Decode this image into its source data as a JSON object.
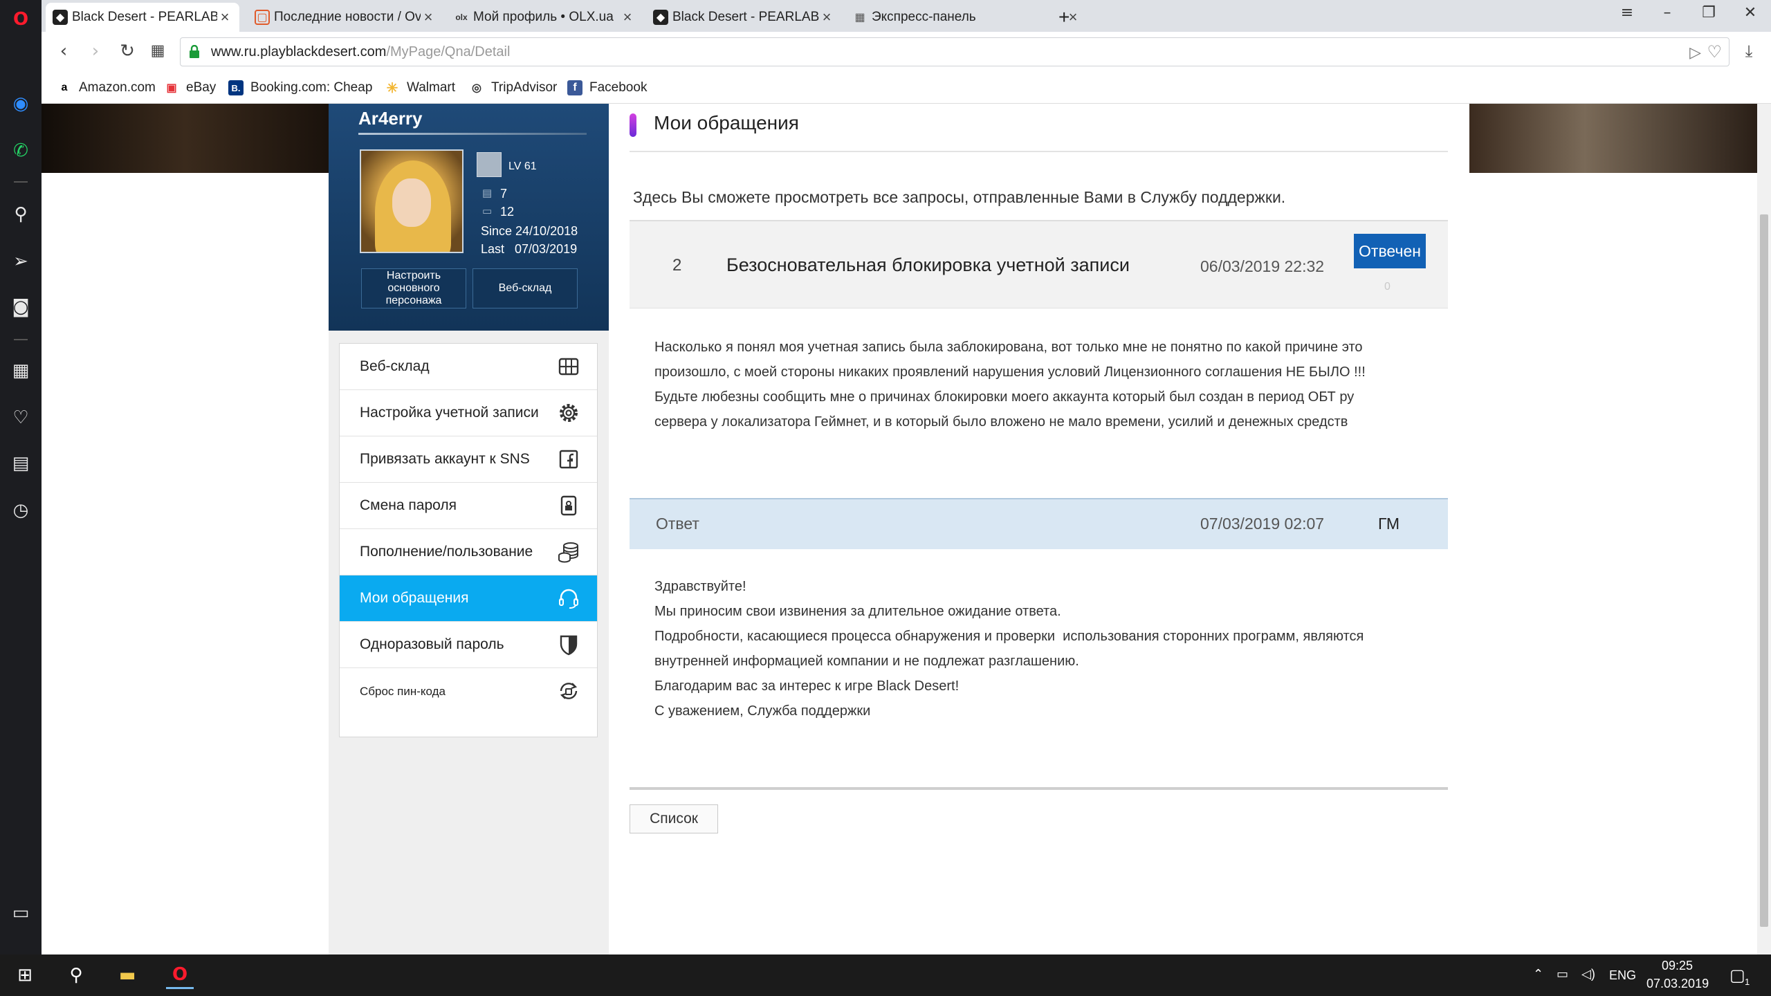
{
  "browser": {
    "tabs": [
      {
        "title": "Black Desert - PEARLABYSS",
        "active": true
      },
      {
        "title": "Последние новости / Overclockers"
      },
      {
        "title": "Мой профиль • OLX.ua"
      },
      {
        "title": "Black Desert - PEARLABYSS"
      },
      {
        "title": "Экспресс-панель"
      }
    ],
    "new_tab": "+",
    "url_host": "www.ru.playblackdesert.com",
    "url_path": "/MyPage/Qna/Detail",
    "bookmarks": [
      {
        "label": "Amazon.com",
        "icon": "a",
        "color": "#000000"
      },
      {
        "label": "eBay",
        "icon": "▣",
        "color": "#e53238"
      },
      {
        "label": "Booking.com: Cheap",
        "icon": "B.",
        "color": "#003580"
      },
      {
        "label": "Walmart",
        "icon": "✳",
        "color": "#f2b632"
      },
      {
        "label": "TripAdvisor",
        "icon": "◎",
        "color": "#333333"
      },
      {
        "label": "Facebook",
        "icon": "f",
        "color": "#3b5998"
      }
    ]
  },
  "profile": {
    "name": "Ar4erry",
    "level": "LV 61",
    "stat1": "7",
    "stat2": "12",
    "since": "Since 24/10/2018",
    "last": "Last   07/03/2019",
    "btn_main_char": "Настроить основного персонажа",
    "btn_web_storage": "Веб-склад"
  },
  "menu": [
    {
      "label": "Веб-склад",
      "icon": "storage-icon"
    },
    {
      "label": "Настройка учетной записи",
      "icon": "gear-icon"
    },
    {
      "label": "Привязать аккаунт к SNS",
      "icon": "facebook-icon"
    },
    {
      "label": "Смена пароля",
      "icon": "lock-icon"
    },
    {
      "label": "Пополнение/пользование",
      "icon": "coins-icon"
    },
    {
      "label": "Мои обращения",
      "icon": "headset-icon",
      "active": true
    },
    {
      "label": "Одноразовый пароль",
      "icon": "shield-icon"
    },
    {
      "label": "Сброс пин-кода",
      "icon": "reset-icon"
    }
  ],
  "main": {
    "title": "Мои обращения",
    "intro": "Здесь Вы сможете просмотреть все запросы, отправленные Вами в Службу поддержки.",
    "question": {
      "number": "2",
      "title": "Безосновательная блокировка учетной записи",
      "date": "06/03/2019 22:32",
      "status": "Отвечен",
      "count": "0",
      "body": [
        "Насколько я понял моя учетная запись была заблокирована, вот только мне не понятно по какой причине это",
        "произошло, с моей стороны никаких проявлений нарушения условий Лицензионного соглашения НЕ БЫЛО !!!",
        "Будьте любезны сообщить мне о причинах блокировки моего аккаунта который был создан в период ОБТ ру",
        "сервера у локализатора Геймнет, и в который было вложено не мало времени, усилий и денежных средств"
      ]
    },
    "answer": {
      "label": "Ответ",
      "date": "07/03/2019 02:07",
      "author": "ГМ",
      "body": [
        "Здравствуйте!",
        "Мы приносим свои извинения за длительное ожидание ответа.",
        "Подробности, касающиеся процесса обнаружения и проверки  использования сторонних программ, являются",
        "внутренней информацией компании и не подлежат разглашению.",
        "Благодарим вас за интерес к игре Black Desert!",
        "С уважением, Служба поддержки"
      ]
    },
    "list_button": "Список"
  },
  "taskbar": {
    "lang": "ENG",
    "time": "09:25",
    "date": "07.03.2019",
    "notifications": "1"
  },
  "colors": {
    "accent_blue": "#0aaaf0",
    "status_blue": "#1261b5",
    "profile_bg": "#1f4a78"
  }
}
